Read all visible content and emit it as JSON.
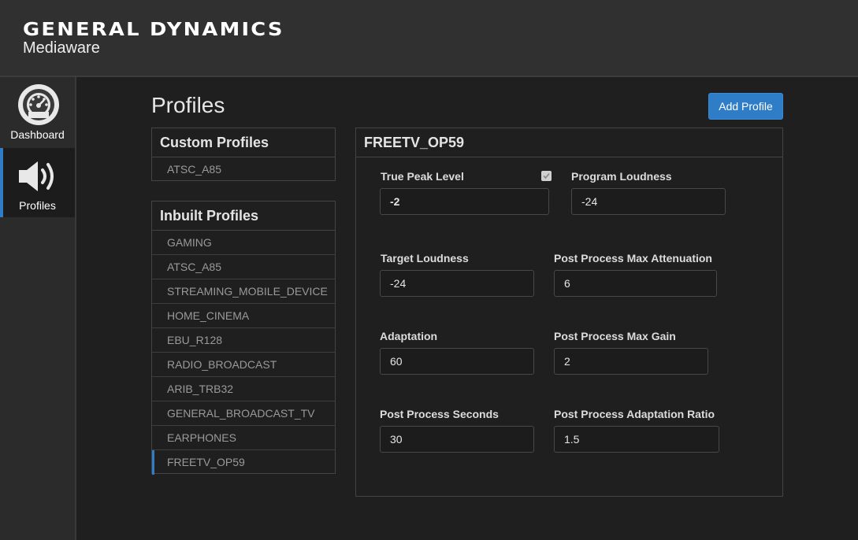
{
  "brand": {
    "name": "GENERAL DYNAMICS",
    "sub": "Mediaware"
  },
  "nav": {
    "dashboard": "Dashboard",
    "profiles": "Profiles"
  },
  "page": {
    "title": "Profiles",
    "add_button": "Add Profile"
  },
  "custom_profiles": {
    "heading": "Custom Profiles",
    "items": [
      "ATSC_A85"
    ]
  },
  "inbuilt_profiles": {
    "heading": "Inbuilt Profiles",
    "items": [
      "GAMING",
      "ATSC_A85",
      "STREAMING_MOBILE_DEVICE",
      "HOME_CINEMA",
      "EBU_R128",
      "RADIO_BROADCAST",
      "ARIB_TRB32",
      "GENERAL_BROADCAST_TV",
      "EARPHONES",
      "FREETV_OP59"
    ],
    "selected": "FREETV_OP59"
  },
  "detail": {
    "title": "FREETV_OP59",
    "true_peak_checked": true,
    "fields": {
      "true_peak_level": {
        "label": "True Peak Level",
        "value": "-2"
      },
      "program_loudness": {
        "label": "Program Loudness",
        "value": "-24"
      },
      "target_loudness": {
        "label": "Target Loudness",
        "value": "-24"
      },
      "pp_max_attenuation": {
        "label": "Post Process Max Attenuation",
        "value": "6"
      },
      "adaptation": {
        "label": "Adaptation",
        "value": "60"
      },
      "pp_max_gain": {
        "label": "Post Process Max Gain",
        "value": "2"
      },
      "pp_seconds": {
        "label": "Post Process Seconds",
        "value": "30"
      },
      "pp_adaptation_ratio": {
        "label": "Post Process Adaptation Ratio",
        "value": "1.5"
      }
    }
  },
  "colors": {
    "accent": "#2f7cc7",
    "background": "#1f1f1f",
    "header": "#303030"
  }
}
